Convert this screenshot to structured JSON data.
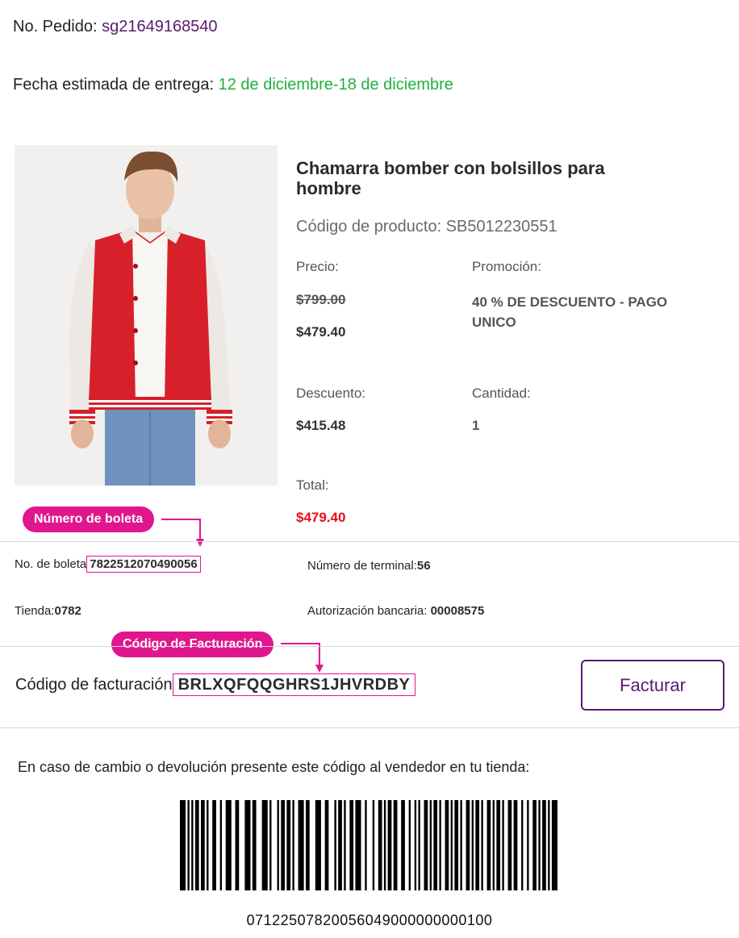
{
  "order": {
    "label": "No. Pedido:",
    "number": "sg21649168540"
  },
  "delivery": {
    "label": "Fecha estimada de entrega:",
    "range": "12 de diciembre-18 de diciembre"
  },
  "product": {
    "name": "Chamarra bomber con bolsillos para hombre",
    "code_label": "Código de producto:",
    "code": "SB5012230551",
    "price_label": "Precio:",
    "original_price": "$799.00",
    "price": "$479.40",
    "promotion_label": "Promoción:",
    "promotion": "40 % DE DESCUENTO - PAGO UNICO",
    "discount_label": "Descuento:",
    "discount": "$415.48",
    "quantity_label": "Cantidad:",
    "quantity": "1",
    "total_label": "Total:",
    "total": "$479.40"
  },
  "receipt": {
    "callout_receipt": "Número de boleta",
    "receipt_label": "No. de boleta",
    "receipt_number": "7822512070490056",
    "terminal_label": "Número de terminal:",
    "terminal": "56",
    "store_label": "Tienda:",
    "store": "0782",
    "auth_label": "Autorización bancaria:",
    "auth": "00008575"
  },
  "billing": {
    "callout_billing": "Código de Facturación",
    "label": "Código de facturación",
    "code": "BRLXQFQQGHRS1JHVRDBY",
    "button": "Facturar"
  },
  "returns": {
    "text": "En caso de cambio o devolución presente este código al vendedor en tu tienda:",
    "barcode_number": "07122507820056049000000000100"
  },
  "colors": {
    "brand_purple": "#5a1a6e",
    "delivery_green": "#1fb23c",
    "total_red": "#e0111b",
    "highlight_pink": "#e0168e"
  }
}
